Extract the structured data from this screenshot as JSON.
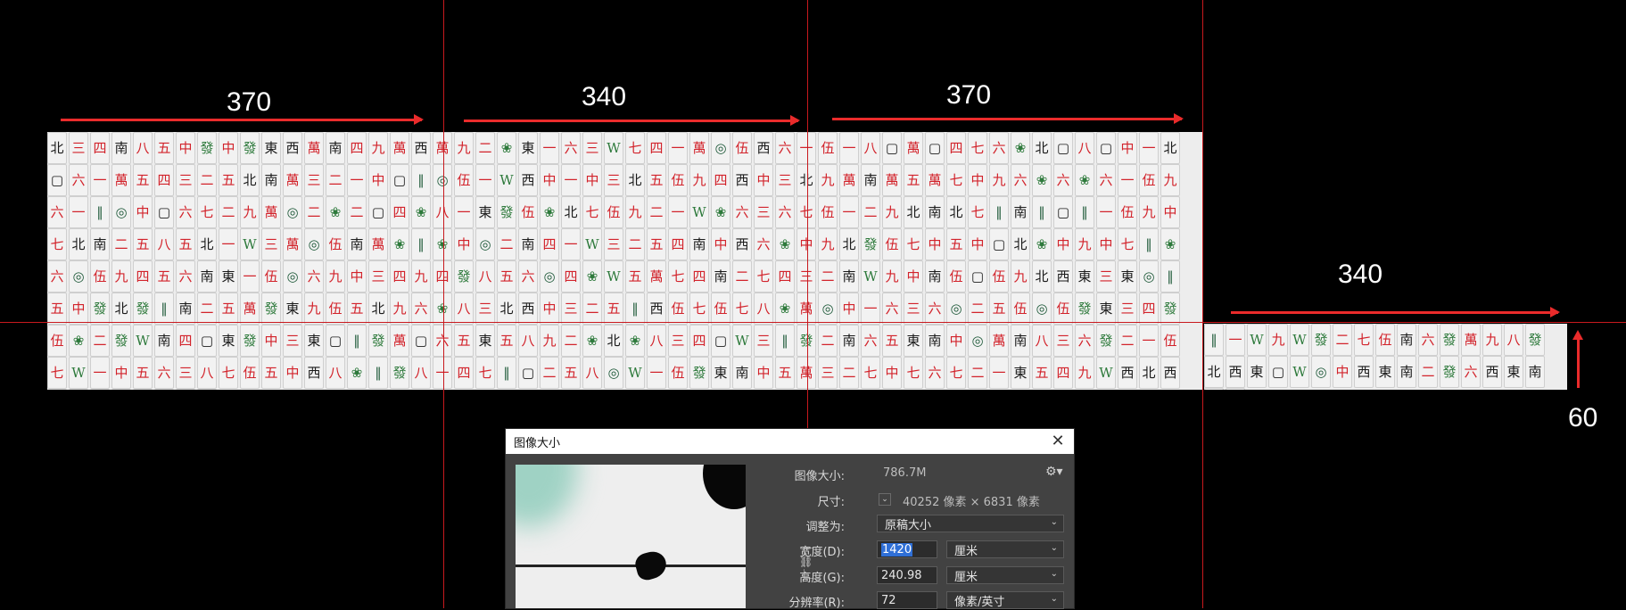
{
  "measurements": {
    "top_1": "370",
    "top_2": "340",
    "top_3": "370",
    "right_width": "340",
    "right_height": "60"
  },
  "tiles": {
    "symbols": [
      "中",
      "南",
      "東",
      "西",
      "北",
      "發",
      "萬",
      "一",
      "二",
      "三",
      "四",
      "五",
      "六",
      "七",
      "八",
      "九",
      "伍",
      "◎",
      "‖",
      "▢",
      "W",
      "❀"
    ]
  },
  "dialog": {
    "title": "图像大小",
    "close_icon": "close-icon",
    "image_size_label": "图像大小:",
    "image_size_value": "786.7M",
    "gear_icon": "gear-icon",
    "dimensions_label": "尺寸:",
    "dimensions_value": "40252 像素  ×  6831 像素",
    "resize_to_label": "调整为:",
    "resize_to_value": "原稿大小",
    "width_label": "宽度(D):",
    "width_value": "1420",
    "width_unit": "厘米",
    "height_label": "高度(G):",
    "height_value": "240.98",
    "height_unit": "厘米",
    "resolution_label": "分辨率(R):",
    "resolution_value": "72",
    "resolution_unit": "像素/英寸",
    "chain_icon": "link-chain-icon"
  },
  "colors": {
    "guide_red": "#c8191e",
    "arrow_red": "#ea2b2b",
    "dialog_bg": "#424242",
    "selection_blue": "#2f6fd6"
  }
}
